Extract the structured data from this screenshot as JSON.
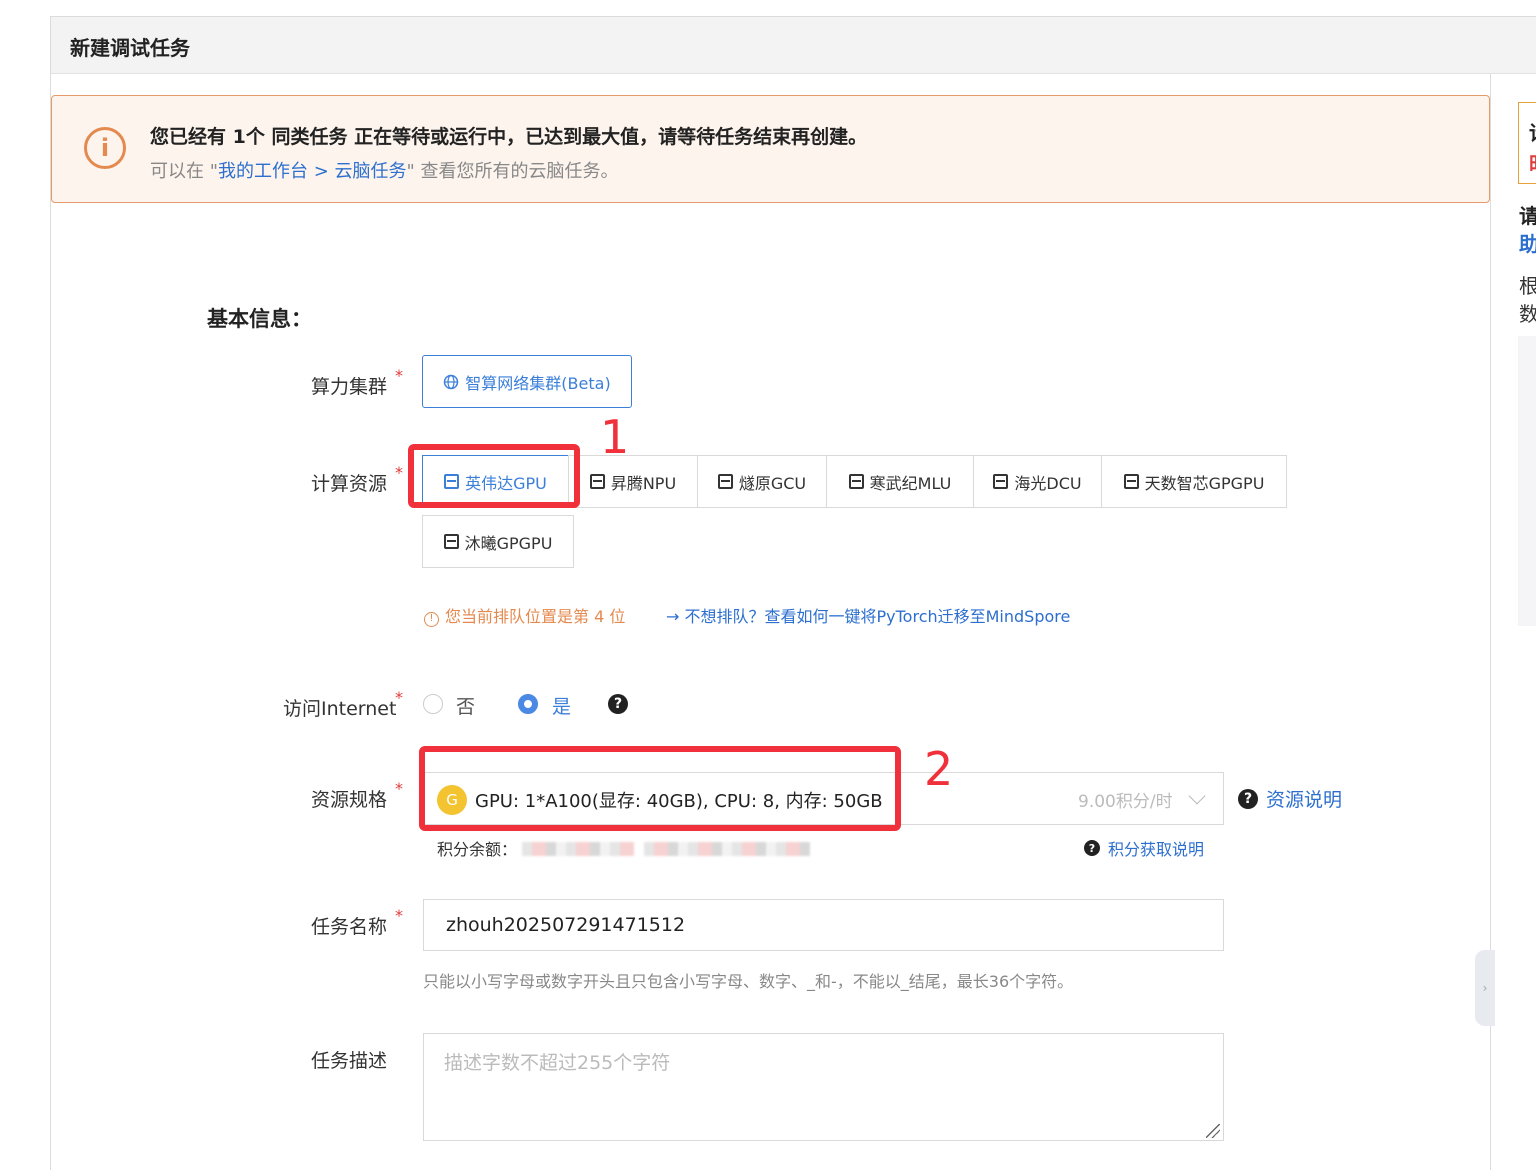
{
  "header": {
    "title": "新建调试任务"
  },
  "alert": {
    "title": "您已经有 1个 同类任务 正在等待或运行中，已达到最大值，请等待任务结束再创建。",
    "sub_prefix": "可以在 \"",
    "sub_link": "我的工作台 > 云脑任务",
    "sub_suffix": "\" 查看您所有的云脑任务。"
  },
  "section_title": "基本信息：",
  "fields": {
    "cluster": {
      "label": "算力集群",
      "options": [
        {
          "label": "智算网络集群(Beta)",
          "selected": true
        }
      ]
    },
    "compute": {
      "label": "计算资源",
      "options": [
        {
          "label": "英伟达GPU",
          "selected": true
        },
        {
          "label": "昇腾NPU"
        },
        {
          "label": "燧原GCU"
        },
        {
          "label": "寒武纪MLU"
        },
        {
          "label": "海光DCU"
        },
        {
          "label": "天数智芯GPGPU"
        },
        {
          "label": "沐曦GPGPU"
        }
      ],
      "queue_info": "您当前排队位置是第 4 位",
      "queue_link": "不想排队？查看如何一键将PyTorch迁移至MindSpore"
    },
    "internet": {
      "label": "访问Internet",
      "options": [
        {
          "label": "否"
        },
        {
          "label": "是",
          "selected": true
        }
      ]
    },
    "spec": {
      "label": "资源规格",
      "badge": "G",
      "value": "GPU: 1*A100(显存: 40GB), CPU: 8, 内存: 50GB",
      "price": "9.00积分/时",
      "resource_link": "资源说明",
      "balance_label": "积分余额：",
      "points_link": "积分获取说明"
    },
    "task_name": {
      "label": "任务名称",
      "value": "zhouh202507291471512",
      "hint": "只能以小写字母或数字开头且只包含小写字母、数字、_和-，不能以_结尾，最长36个字符。"
    },
    "task_desc": {
      "label": "任务描述",
      "placeholder": "描述字数不超过255个字符"
    }
  },
  "annotations": {
    "box1": "1",
    "box2": "2"
  },
  "right_panel": {
    "chars": [
      "请",
      "时",
      "请",
      "助",
      "根",
      "数"
    ]
  },
  "colors": {
    "accent": "#3b7fd9",
    "warning": "#e58a4f",
    "annotation": "#f0303a"
  }
}
